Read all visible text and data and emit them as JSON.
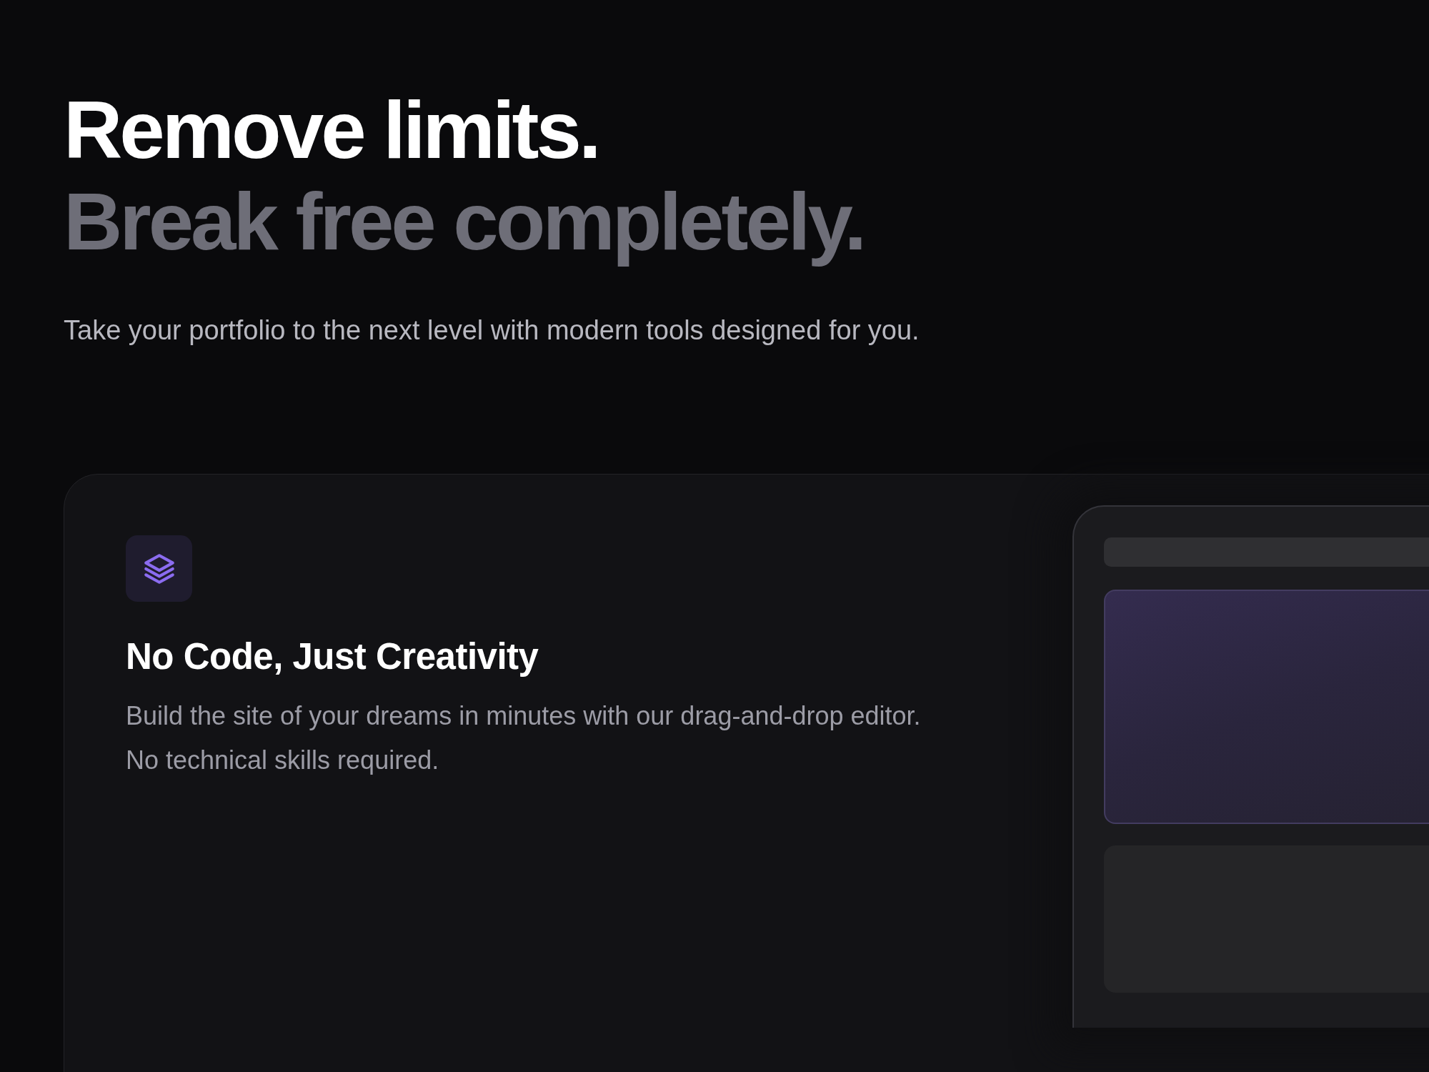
{
  "headline": {
    "line_1": "Remove limits.",
    "line_2": "Break free completely."
  },
  "subtitle": "Take your portfolio to the next level with modern tools designed for you.",
  "feature_card": {
    "title": "No Code, Just Creativity",
    "description": "Build the site of your dreams in minutes with our drag-and-drop editor. No technical skills required."
  }
}
